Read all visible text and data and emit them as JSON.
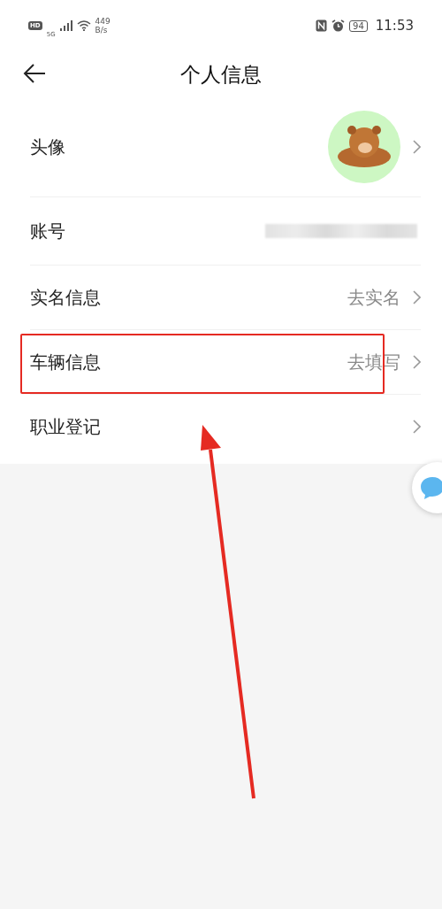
{
  "status_bar": {
    "hd": "HD",
    "network": "5G",
    "speed_value": "449",
    "speed_unit": "B/s",
    "battery": "94",
    "time": "11:53"
  },
  "header": {
    "title": "个人信息"
  },
  "rows": [
    {
      "kind": "avatar",
      "label": "头像",
      "highlighted": false
    },
    {
      "kind": "blurred",
      "label": "账号",
      "highlighted": false
    },
    {
      "kind": "link",
      "label": "实名信息",
      "value": "去实名",
      "highlighted": false
    },
    {
      "kind": "link",
      "label": "车辆信息",
      "value": "去填写",
      "highlighted": true
    },
    {
      "kind": "link",
      "label": "职业登记",
      "highlighted": false
    }
  ]
}
